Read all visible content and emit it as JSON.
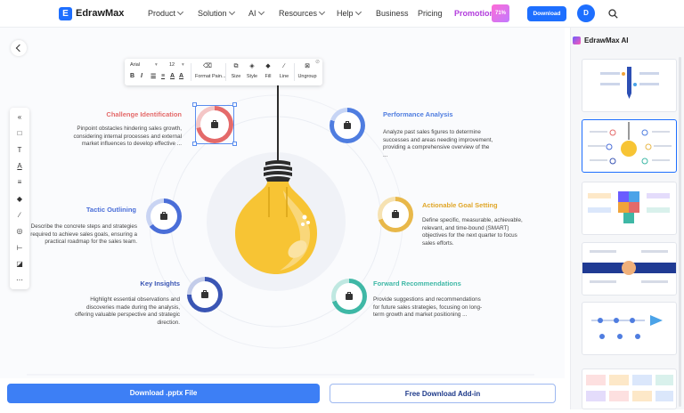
{
  "nav": {
    "logo_text": "EdrawMax",
    "items": [
      {
        "label": "Product",
        "dropdown": true
      },
      {
        "label": "Solution",
        "dropdown": true
      },
      {
        "label": "AI",
        "dropdown": true
      },
      {
        "label": "Resources",
        "dropdown": true
      },
      {
        "label": "Help",
        "dropdown": true
      },
      {
        "label": "Business",
        "dropdown": false
      },
      {
        "label": "Pricing",
        "dropdown": false
      }
    ],
    "promotion": "Promotion",
    "promo_badge": "71%",
    "download": "Download",
    "avatar": "D"
  },
  "toolbar": {
    "font": "Arial",
    "size": "12",
    "format_painter": "Format Pain...",
    "size_label": "Size",
    "style_label": "Style",
    "fill_label": "Fill",
    "line_label": "Line",
    "ungroup_label": "Ungroup"
  },
  "infographic": {
    "items": [
      {
        "title": "Challenge Identification",
        "desc": "Pinpoint obstacles hindering sales growth, considering internal processes and external market influences to develop effective ...",
        "color": "#e46a6a"
      },
      {
        "title": "Performance Analysis",
        "desc": "Analyze past sales figures to determine successes and areas needing improvement, providing a comprehensive overview of the ...",
        "color": "#4f7de0"
      },
      {
        "title": "Tactic Outlining",
        "desc": "Describe the concrete steps and strategies required to achieve sales goals, ensuring a practical roadmap for the sales team.",
        "color": "#4a6ed8"
      },
      {
        "title": "Actionable Goal Setting",
        "desc": "Define specific, measurable, achievable, relevant, and time-bound (SMART) objectives for the next quarter to focus sales efforts.",
        "color": "#e8b84a"
      },
      {
        "title": "Key Insights",
        "desc": "Highlight essential observations and discoveries made during the analysis, offering valuable perspective and strategic direction.",
        "color": "#3a55b4"
      },
      {
        "title": "Forward Recommendations",
        "desc": "Provide suggestions and recommendations for future sales strategies, focusing on long-term growth and market positioning ...",
        "color": "#3fb8a6"
      }
    ]
  },
  "buttons": {
    "download_pptx": "Download .pptx File",
    "free_addin": "Free Download Add-in"
  },
  "sidebar": {
    "title": "EdrawMax AI"
  },
  "colors": {
    "brand": "#1e6fff",
    "promotion": "#b23bdc"
  }
}
